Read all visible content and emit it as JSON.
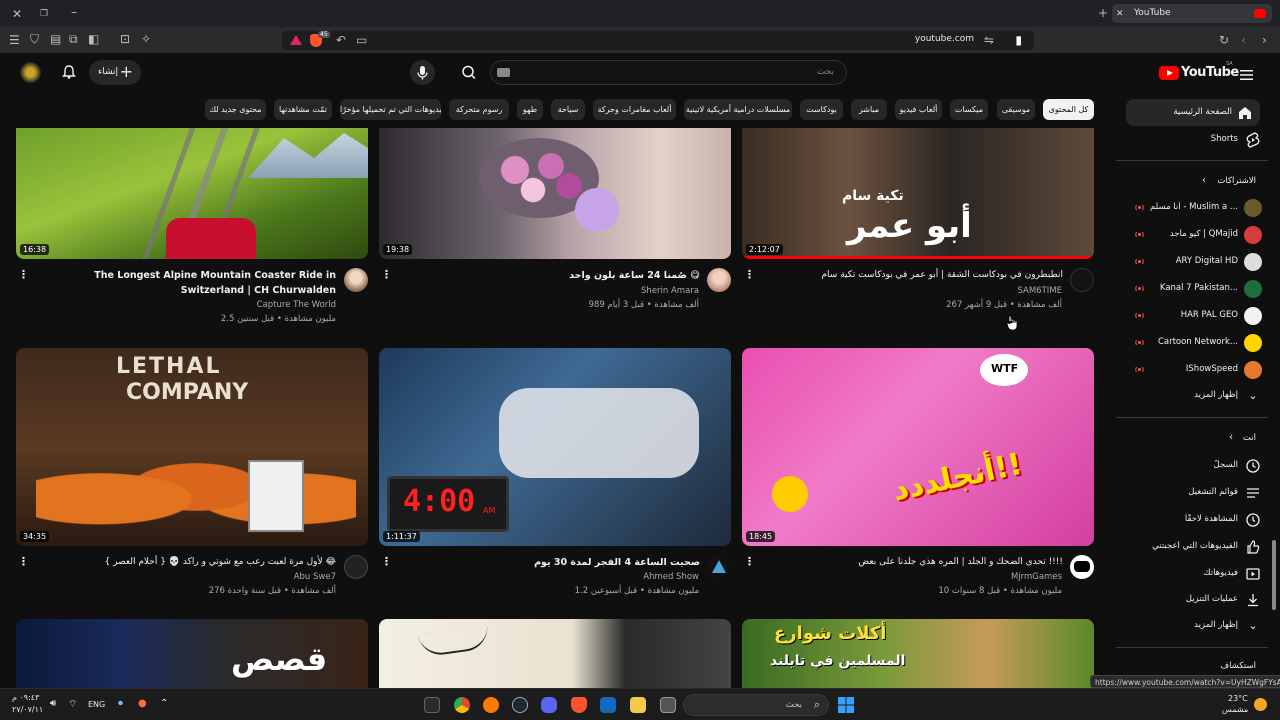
{
  "browser": {
    "tab_title": "YouTube",
    "url": "youtube.com",
    "extension_badge": "45"
  },
  "header": {
    "logo_text": "YouTube",
    "logo_region": "SA",
    "search_placeholder": "بحث",
    "create_label": "إنشاء"
  },
  "chips": [
    {
      "label": "كل المحتوى",
      "active": true
    },
    {
      "label": "موسيقى"
    },
    {
      "label": "ميكسات"
    },
    {
      "label": "ألعاب فيديو"
    },
    {
      "label": "مباشر"
    },
    {
      "label": "بودكاست"
    },
    {
      "label": "مسلسلات درامية أمريكية لاتينية"
    },
    {
      "label": "ألعاب مغامرات وحركة"
    },
    {
      "label": "سياحة"
    },
    {
      "label": "طهو"
    },
    {
      "label": "رسوم متحركة"
    },
    {
      "label": "الفيديوهات التي تم تحميلها مؤخرًا"
    },
    {
      "label": "تمّت مشاهدتها"
    },
    {
      "label": "محتوى جديد لك"
    }
  ],
  "sidebar": {
    "home": "الصفحة الرئيسية",
    "shorts": "Shorts",
    "subscriptions_title": "الاشتراكات",
    "subscriptions": [
      {
        "name": "أنا مسلم - Muslim a ..."
      },
      {
        "name": "كيو ماجد | QMajid"
      },
      {
        "name": "ARY Digital HD"
      },
      {
        "name": "Kanal 7 Pakistan..."
      },
      {
        "name": "HAR PAL GEO"
      },
      {
        "name": "Cartoon Network..."
      },
      {
        "name": "IShowSpeed"
      }
    ],
    "show_more": "إظهار المزيد",
    "you_title": "أنت",
    "you_items": [
      {
        "label": "السجلّ"
      },
      {
        "label": "قوائم التشغيل"
      },
      {
        "label": "المشاهدة لاحقًا"
      },
      {
        "label": "الفيديوهات التي أعجبتني"
      },
      {
        "label": "فيديوهاتك"
      },
      {
        "label": "عمليات التنزيل"
      }
    ],
    "show_more_2": "إظهار المزيد",
    "explore_title": "استكشاف"
  },
  "videos": [
    {
      "title": "The Longest Alpine Mountain Coaster Ride in Switzerland | CH Churwalden",
      "channel": "Capture The World",
      "meta": "2.5 مليون مشاهدة • قبل سنتين",
      "duration": "16:38"
    },
    {
      "title": "صُمنا 24 ساعة بلون واحد 😋",
      "channel": "Sherin Amara",
      "meta": "989 ألف مشاهدة • قبل 3 أيام",
      "duration": "19:38"
    },
    {
      "title": "انطبطرون في بودكاست الشقة | أبو عمر في بودكاست تكية سام",
      "channel": "SAM6TIME",
      "meta": "267 ألف مشاهدة • قبل 9 أشهر",
      "duration": "2:12:07"
    },
    {
      "title": "لأول مرة لعبت رعب مع شوتي و راكد 💀 { أحلام العصر } 😂",
      "channel": "Abu Swe7",
      "meta": "276 ألف مشاهدة • قبل سنة واحدة",
      "duration": "34:35"
    },
    {
      "title": "صحيت الساعة 4 الفجر لمدة 30 يوم",
      "channel": "Ahmed Show",
      "meta": "1.2 مليون مشاهدة • قبل أسبوعين",
      "duration": "1:11:37"
    },
    {
      "title": "تحدي الضحك و الجلد | المره هذي جلدنا على بعض !!!!",
      "channel": "MjrmGames",
      "meta": "10 مليون مشاهدة • قبل 8 سنوات",
      "duration": "18:45"
    }
  ],
  "thumb_texts": {
    "lethal": "LETHAL",
    "company": "COMPANY",
    "clock": "4:00",
    "clock_am": "AM",
    "abu_omar": "أبو عمر",
    "takiya": "تكية سام",
    "anjaldadd": "أنجلددد!!",
    "wtf": "WTF",
    "qasas": "قصص",
    "aklat": "أكلات شوارع",
    "muslimin": "المسلمين في تايلند"
  },
  "status_url": "https://www.youtube.com/watch?v=UyHZWgFYsA",
  "taskbar": {
    "search": "بحث",
    "lang": "ENG",
    "time": "٠٩:٤٣ م",
    "date": "٢٧/٠٧/١١",
    "weather_temp": "23°C",
    "weather_desc": "مشمس"
  },
  "colors": {
    "bg": "#0f0f0f",
    "chip": "#272727",
    "yt_red": "#ff0000",
    "accent_live": "#ff4e45"
  }
}
